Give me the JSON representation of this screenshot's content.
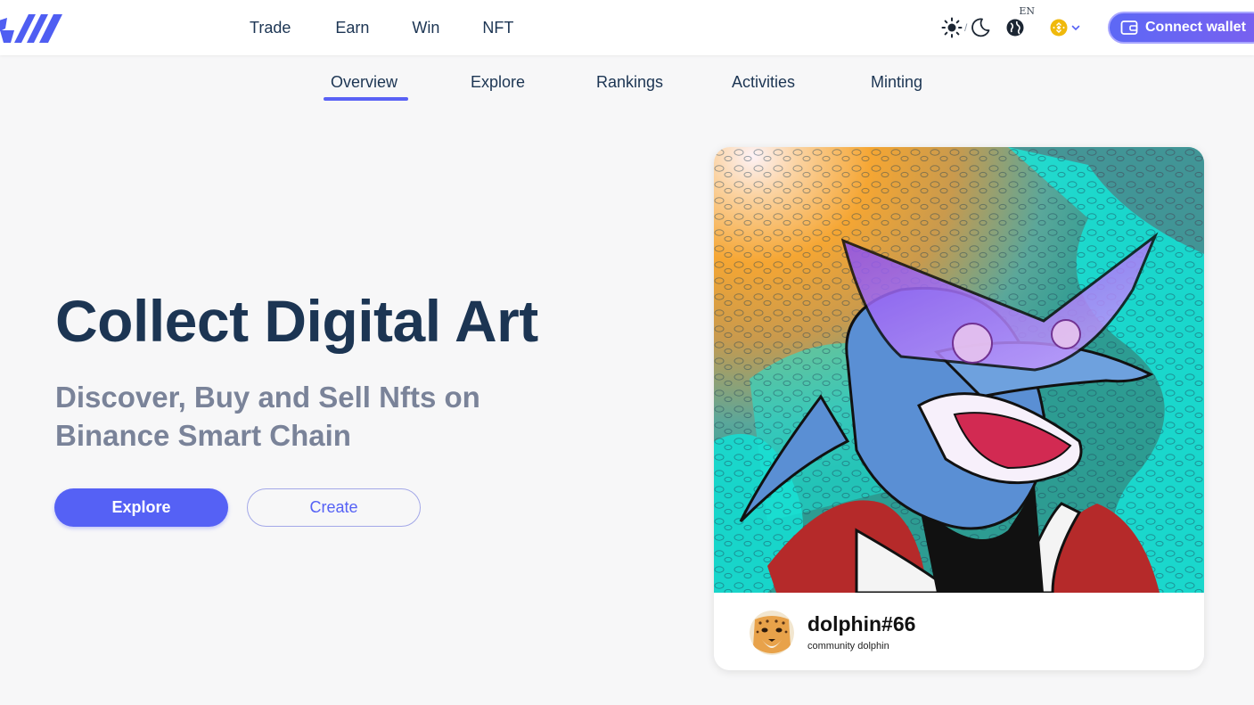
{
  "header": {
    "nav": [
      "Trade",
      "Earn",
      "Win",
      "NFT"
    ],
    "language": "EN",
    "theme_separator": "/",
    "connect_label": "Connect wallet"
  },
  "subnav": {
    "tabs": [
      "Overview",
      "Explore",
      "Rankings",
      "Activities",
      "Minting"
    ],
    "active": "Overview"
  },
  "hero": {
    "title": "Collect Digital Art",
    "subtitle": "Discover, Buy and Sell Nfts on Binance Smart Chain",
    "primary_button": "Explore",
    "secondary_button": "Create"
  },
  "featured_nft": {
    "name": "dolphin#66",
    "collection": "community dolphin"
  },
  "colors": {
    "brand": "#5561f5",
    "title": "#1c3553",
    "subtitle": "#7a8399",
    "bnb": "#f0b90b"
  }
}
